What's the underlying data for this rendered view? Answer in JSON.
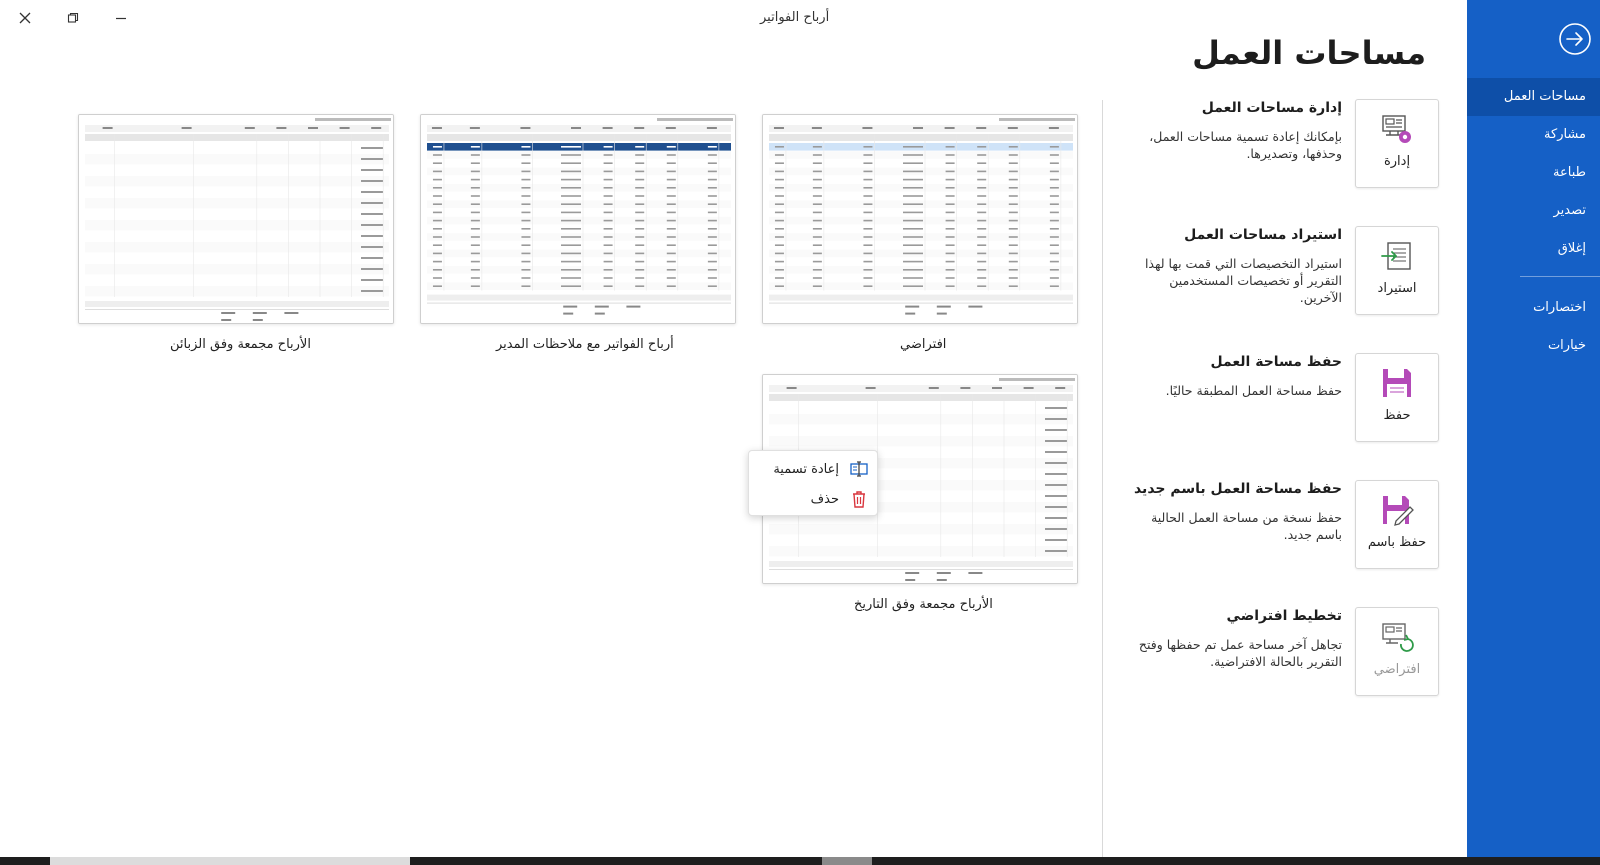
{
  "window": {
    "title": "أرباح الفواتير"
  },
  "sidebar": {
    "items": [
      {
        "label": "مساحات العمل",
        "active": true
      },
      {
        "label": "مشاركة"
      },
      {
        "label": "طباعة"
      },
      {
        "label": "تصدير"
      },
      {
        "label": "إغلاق"
      }
    ],
    "bottom_items": [
      {
        "label": "اختصارات"
      },
      {
        "label": "خيارات"
      }
    ]
  },
  "page": {
    "heading": "مساحات العمل"
  },
  "actions": [
    {
      "name": "إدارة مساحات العمل",
      "desc": "بإمكانك إعادة تسمية مساحات العمل، وحذفها، وتصديرها.",
      "tile_label": "إدارة",
      "icon": "manage-workspace-icon"
    },
    {
      "name": "استيراد مساحات العمل",
      "desc": "استيراد التخصيصات التي قمت بها لهذا التقرير أو تخصيصات المستخدمين الآخرين.",
      "tile_label": "استيراد",
      "icon": "import-icon"
    },
    {
      "name": "حفظ مساحة العمل",
      "desc": "حفظ مساحة العمل المطبقة حاليًا.",
      "tile_label": "حفظ",
      "icon": "save-icon"
    },
    {
      "name": "حفظ مساحة العمل باسم جديد",
      "desc": "حفظ نسخة من مساحة العمل الحالية باسم جديد.",
      "tile_label": "حفظ باسم",
      "icon": "save-as-icon"
    },
    {
      "name": "تخطيط افتراضي",
      "desc": "تجاهل آخر مساحة عمل تم حفظها وفتح التقرير بالحالة الافتراضية.",
      "tile_label": "افتراضي",
      "icon": "reset-layout-icon",
      "disabled": true
    }
  ],
  "workspaces": [
    {
      "label": "افتراضي"
    },
    {
      "label": "أرباح الفواتير مع ملاحظات المدير"
    },
    {
      "label": "الأرباح مجمعة وفق الزبائن"
    },
    {
      "label": "الأرباح مجمعة وفق التاريخ"
    }
  ],
  "context_menu": {
    "items": [
      {
        "label": "إعادة تسمية",
        "icon": "rename-icon"
      },
      {
        "label": "حذف",
        "icon": "trash-icon"
      }
    ]
  },
  "colors": {
    "sidebar": "#1560c6",
    "sidebar_active": "#0e4fa8",
    "accent_purple": "#b44ab8",
    "selection_row": "#1f4f8f",
    "delete_red": "#d9363e"
  }
}
